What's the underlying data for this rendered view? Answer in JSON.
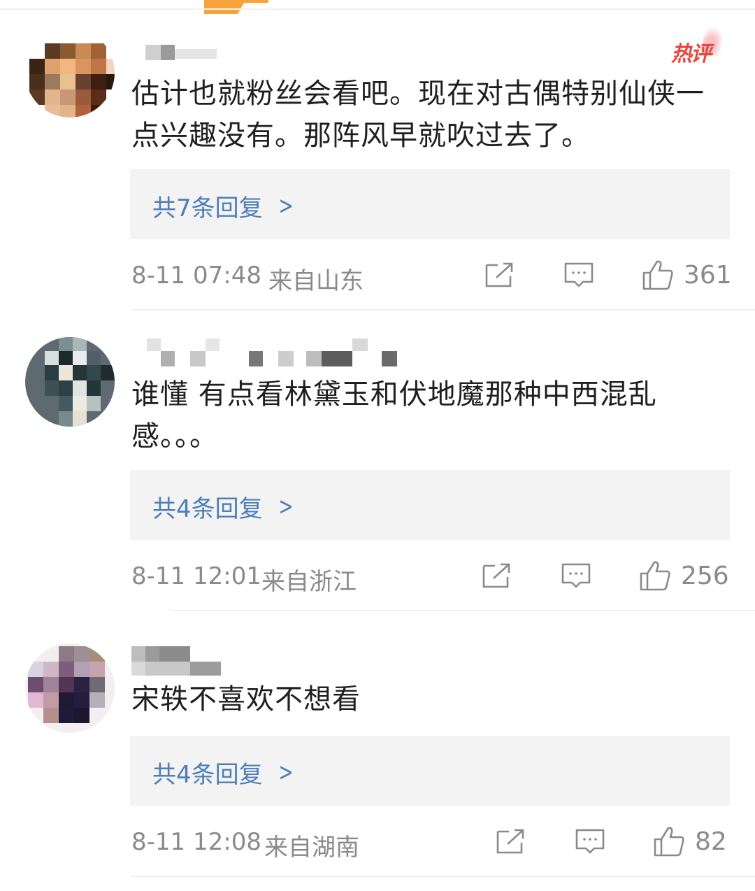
{
  "comments": [
    {
      "badge": "热评",
      "content": "估计也就粉丝会看吧。现在对古偶特别仙侠一点兴趣没有。那阵风早就吹过去了。",
      "reply_label": "共7条回复",
      "time": "8-11 07:48",
      "location": "来自山东",
      "likes": "361"
    },
    {
      "content": "谁懂 有点看林黛玉和伏地魔那种中西混乱感。。。",
      "reply_label": "共4条回复",
      "time": "8-11 12:01",
      "location": "来自浙江",
      "likes": "256"
    },
    {
      "content": "宋轶不喜欢不想看",
      "reply_label": "共4条回复",
      "time": "8-11 12:08",
      "location": "来自湖南",
      "likes": "82"
    }
  ],
  "icons": {
    "share": "share-icon",
    "comment": "comment-icon",
    "like": "like-icon",
    "chevron": "chevron-right-icon"
  },
  "colors": {
    "link": "#4d7eb8",
    "hot": "#e8463f",
    "meta": "#8a8a8a",
    "reply_bg": "#f3f3f3"
  }
}
